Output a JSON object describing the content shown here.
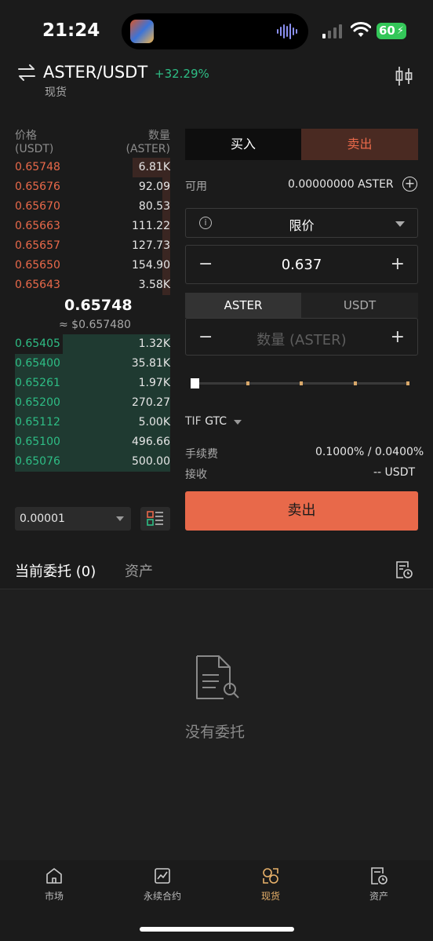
{
  "status": {
    "time": "21:24",
    "battery": "60"
  },
  "header": {
    "pair": "ASTER/USDT",
    "change": "+32.29%",
    "market": "现货"
  },
  "orderbook": {
    "price_header": "价格",
    "price_unit": "(USDT)",
    "qty_header": "数量",
    "qty_unit": "(ASTER)",
    "asks": [
      {
        "price": "0.65748",
        "qty": "6.81K",
        "depth": 0.24
      },
      {
        "price": "0.65676",
        "qty": "92.09",
        "depth": 0.05
      },
      {
        "price": "0.65670",
        "qty": "80.53",
        "depth": 0.05
      },
      {
        "price": "0.65663",
        "qty": "111.22",
        "depth": 0.05
      },
      {
        "price": "0.65657",
        "qty": "127.73",
        "depth": 0.05
      },
      {
        "price": "0.65650",
        "qty": "154.90",
        "depth": 0.05
      },
      {
        "price": "0.65643",
        "qty": "3.58K",
        "depth": 0.05
      }
    ],
    "last_price": "0.65748",
    "last_price_usd": "≈ $0.657480",
    "bids": [
      {
        "price": "0.65405",
        "qty": "1.32K",
        "depth": 0.69
      },
      {
        "price": "0.65400",
        "qty": "35.81K",
        "depth": 1.0
      },
      {
        "price": "0.65261",
        "qty": "1.97K",
        "depth": 1.0
      },
      {
        "price": "0.65200",
        "qty": "270.27",
        "depth": 1.0
      },
      {
        "price": "0.65112",
        "qty": "5.00K",
        "depth": 1.0
      },
      {
        "price": "0.65100",
        "qty": "496.66",
        "depth": 1.0
      },
      {
        "price": "0.65076",
        "qty": "500.00",
        "depth": 1.0
      }
    ],
    "tick_size": "0.00001"
  },
  "trade": {
    "buy_tab": "买入",
    "sell_tab": "卖出",
    "available_label": "可用",
    "available_value": "0.00000000 ASTER",
    "order_type": "限价",
    "price": "0.637",
    "unit_a": "ASTER",
    "unit_b": "USDT",
    "qty_placeholder": "数量 (ASTER)",
    "slider_percent": 0,
    "tif_label": "TIF",
    "tif_value": "GTC",
    "fee_label": "手续费",
    "fee_value": "0.1000% / 0.0400%",
    "receive_label": "接收",
    "receive_value": "-- USDT",
    "submit_label": "卖出"
  },
  "orders": {
    "tab_current": "当前委托 (0)",
    "tab_assets": "资产",
    "empty_text": "没有委托"
  },
  "nav": [
    {
      "label": "市场",
      "icon": "home-icon"
    },
    {
      "label": "永续合约",
      "icon": "chart-icon"
    },
    {
      "label": "现货",
      "icon": "spot-icon",
      "active": true
    },
    {
      "label": "资产",
      "icon": "wallet-icon"
    }
  ],
  "colors": {
    "sell": "#e8694a",
    "buy": "#2ebd85",
    "accent": "#e8b16a"
  }
}
